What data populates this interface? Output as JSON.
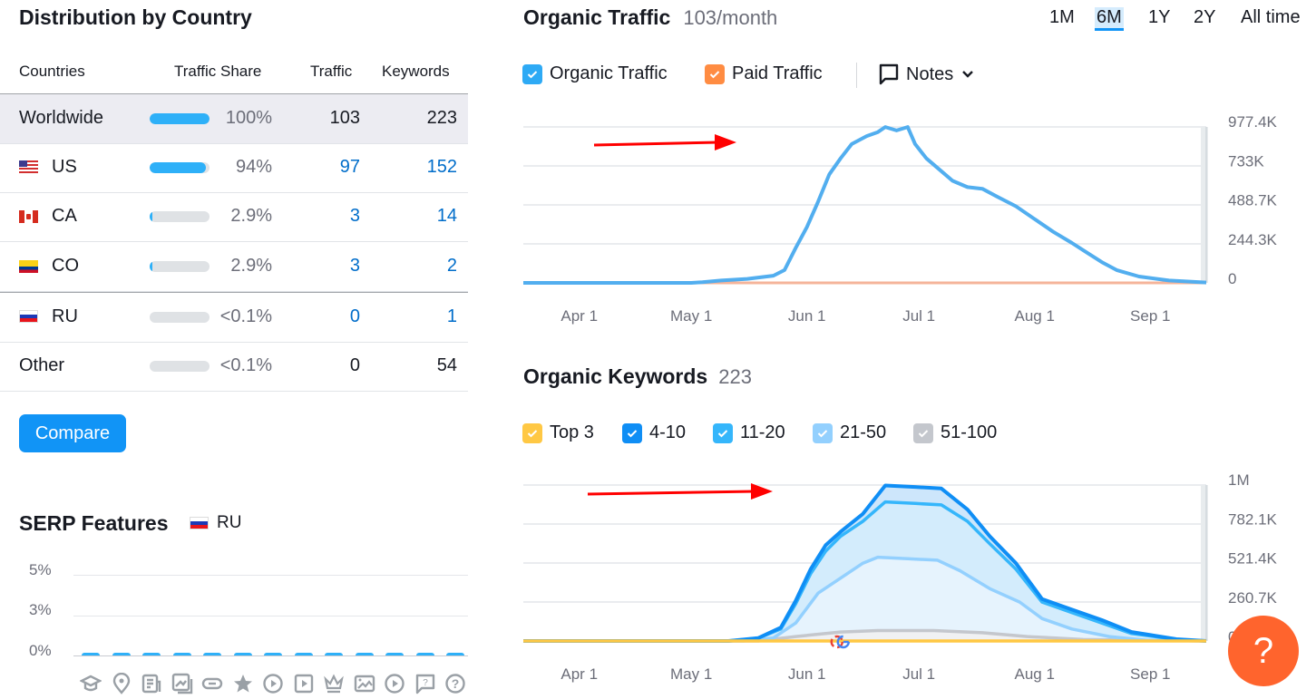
{
  "distribution": {
    "title": "Distribution by Country",
    "columns": [
      "Countries",
      "Traffic Share",
      "Traffic",
      "Keywords"
    ],
    "rows": [
      {
        "country": "Worldwide",
        "flag": "",
        "share_label": "100%",
        "share": 100,
        "traffic": "103",
        "keywords": "223",
        "linked": false
      },
      {
        "country": "US",
        "flag": "us-flag",
        "share_label": "94%",
        "share": 94,
        "traffic": "97",
        "keywords": "152",
        "linked": true
      },
      {
        "country": "CA",
        "flag": "ca-flag",
        "share_label": "2.9%",
        "share": 2.9,
        "traffic": "3",
        "keywords": "14",
        "linked": true
      },
      {
        "country": "CO",
        "flag": "co-flag",
        "share_label": "2.9%",
        "share": 2.9,
        "traffic": "3",
        "keywords": "2",
        "linked": true
      },
      {
        "country": "RU",
        "flag": "ru-flag",
        "share_label": "<0.1%",
        "share": 0,
        "traffic": "0",
        "keywords": "1",
        "linked": true
      },
      {
        "country": "Other",
        "flag": "",
        "share_label": "<0.1%",
        "share": 0,
        "traffic": "0",
        "keywords": "54",
        "linked": false
      }
    ],
    "compare_label": "Compare"
  },
  "serp": {
    "title": "SERP Features",
    "country": "RU",
    "y_ticks": [
      "5%",
      "3%",
      "0%"
    ],
    "icons": [
      "knowledge-panel-icon",
      "local-pack-icon",
      "top-stories-icon",
      "image-pack-icon",
      "sitelinks-icon",
      "reviews-icon",
      "video-icon",
      "featured-video-icon",
      "top-ranking-icon",
      "image-icon",
      "video-carousel-icon",
      "faq-icon",
      "people-also-ask-icon"
    ],
    "values": [
      0,
      0,
      0,
      0,
      0,
      0,
      0,
      0,
      0,
      0,
      0,
      0,
      0
    ]
  },
  "organic_traffic": {
    "title": "Organic Traffic",
    "value": "103/month",
    "ranges": [
      "1M",
      "6M",
      "1Y",
      "2Y",
      "All time"
    ],
    "active_range": "6M",
    "legend": [
      {
        "label": "Organic Traffic",
        "color": "#2eaaf5",
        "checked": true
      },
      {
        "label": "Paid Traffic",
        "color": "#ff8c42",
        "checked": true
      }
    ],
    "notes_label": "Notes"
  },
  "organic_keywords": {
    "title": "Organic Keywords",
    "value": "223",
    "legend": [
      {
        "label": "Top 3",
        "color": "#ffc844",
        "checked": true
      },
      {
        "label": "4-10",
        "color": "#0f8ef5",
        "checked": true
      },
      {
        "label": "11-20",
        "color": "#35b6fb",
        "checked": true
      },
      {
        "label": "21-50",
        "color": "#93d0fe",
        "checked": true
      },
      {
        "label": "51-100",
        "color": "#c4c7cd",
        "checked": true
      }
    ]
  },
  "help_label": "?",
  "chart_data": [
    {
      "type": "line",
      "title": "Organic Traffic",
      "x_ticks": [
        "Apr 1",
        "May 1",
        "Jun 1",
        "Jul 1",
        "Aug 1",
        "Sep 1"
      ],
      "y_ticks": [
        "977.4K",
        "733K",
        "488.7K",
        "244.3K",
        "0"
      ],
      "ylim": [
        0,
        977400
      ],
      "x_range_days": [
        -15,
        168
      ],
      "series": [
        {
          "name": "Organic Traffic",
          "color": "#52aeef",
          "points": [
            [
              -15,
              0
            ],
            [
              30,
              0
            ],
            [
              33,
              4000
            ],
            [
              38,
              15000
            ],
            [
              45,
              25000
            ],
            [
              52,
              45000
            ],
            [
              55,
              80000
            ],
            [
              58,
              220000
            ],
            [
              61,
              350000
            ],
            [
              64,
              510000
            ],
            [
              67,
              680000
            ],
            [
              70,
              780000
            ],
            [
              73,
              870000
            ],
            [
              77,
              920000
            ],
            [
              80,
              945000
            ],
            [
              82,
              977000
            ],
            [
              85,
              955000
            ],
            [
              88,
              977000
            ],
            [
              90,
              870000
            ],
            [
              93,
              780000
            ],
            [
              97,
              700000
            ],
            [
              100,
              640000
            ],
            [
              104,
              600000
            ],
            [
              108,
              590000
            ],
            [
              112,
              540000
            ],
            [
              117,
              480000
            ],
            [
              122,
              400000
            ],
            [
              127,
              320000
            ],
            [
              132,
              250000
            ],
            [
              136,
              190000
            ],
            [
              140,
              130000
            ],
            [
              144,
              80000
            ],
            [
              150,
              40000
            ],
            [
              158,
              15000
            ],
            [
              168,
              2000
            ]
          ]
        },
        {
          "name": "Paid Traffic",
          "color": "#f5b49a",
          "points": [
            [
              -15,
              0
            ],
            [
              168,
              0
            ]
          ]
        }
      ]
    },
    {
      "type": "area",
      "title": "Organic Keywords",
      "x_ticks": [
        "Apr 1",
        "May 1",
        "Jun 1",
        "Jul 1",
        "Aug 1",
        "Sep 1"
      ],
      "y_ticks": [
        "1M",
        "782.1K",
        "521.4K",
        "260.7K",
        "0"
      ],
      "ylim": [
        0,
        1042800
      ],
      "x_range_days": [
        -15,
        168
      ],
      "series": [
        {
          "name": "51-100",
          "color": "#c4c7cd",
          "points": [
            [
              -15,
              0
            ],
            [
              48,
              0
            ],
            [
              58,
              30000
            ],
            [
              70,
              60000
            ],
            [
              80,
              70000
            ],
            [
              95,
              70000
            ],
            [
              108,
              55000
            ],
            [
              120,
              30000
            ],
            [
              135,
              10000
            ],
            [
              168,
              0
            ]
          ]
        },
        {
          "name": "21-50",
          "color": "#93d0fe",
          "points": [
            [
              -15,
              0
            ],
            [
              44,
              0
            ],
            [
              52,
              20000
            ],
            [
              58,
              120000
            ],
            [
              64,
              320000
            ],
            [
              70,
              420000
            ],
            [
              76,
              520000
            ],
            [
              80,
              560000
            ],
            [
              88,
              550000
            ],
            [
              96,
              540000
            ],
            [
              102,
              470000
            ],
            [
              110,
              350000
            ],
            [
              118,
              260000
            ],
            [
              124,
              150000
            ],
            [
              132,
              80000
            ],
            [
              142,
              30000
            ],
            [
              152,
              5000
            ],
            [
              168,
              0
            ]
          ]
        },
        {
          "name": "11-20",
          "color": "#35b6fb",
          "points": [
            [
              -15,
              0
            ],
            [
              40,
              0
            ],
            [
              48,
              20000
            ],
            [
              54,
              80000
            ],
            [
              58,
              250000
            ],
            [
              62,
              450000
            ],
            [
              66,
              600000
            ],
            [
              70,
              700000
            ],
            [
              76,
              800000
            ],
            [
              82,
              930000
            ],
            [
              90,
              920000
            ],
            [
              97,
              910000
            ],
            [
              104,
              800000
            ],
            [
              110,
              650000
            ],
            [
              117,
              480000
            ],
            [
              124,
              260000
            ],
            [
              132,
              190000
            ],
            [
              140,
              120000
            ],
            [
              148,
              50000
            ],
            [
              160,
              10000
            ],
            [
              168,
              0
            ]
          ]
        },
        {
          "name": "4-10",
          "color": "#0f8ef5",
          "points": [
            [
              -15,
              0
            ],
            [
              40,
              0
            ],
            [
              48,
              20000
            ],
            [
              54,
              90000
            ],
            [
              58,
              270000
            ],
            [
              62,
              480000
            ],
            [
              66,
              640000
            ],
            [
              70,
              730000
            ],
            [
              76,
              850000
            ],
            [
              82,
              1040000
            ],
            [
              90,
              1030000
            ],
            [
              97,
              1020000
            ],
            [
              104,
              880000
            ],
            [
              110,
              700000
            ],
            [
              117,
              520000
            ],
            [
              124,
              280000
            ],
            [
              132,
              210000
            ],
            [
              140,
              140000
            ],
            [
              148,
              60000
            ],
            [
              160,
              12000
            ],
            [
              168,
              0
            ]
          ]
        },
        {
          "name": "Top 3",
          "color": "#ffc844",
          "points": [
            [
              -15,
              0
            ],
            [
              168,
              0
            ]
          ]
        }
      ]
    }
  ]
}
